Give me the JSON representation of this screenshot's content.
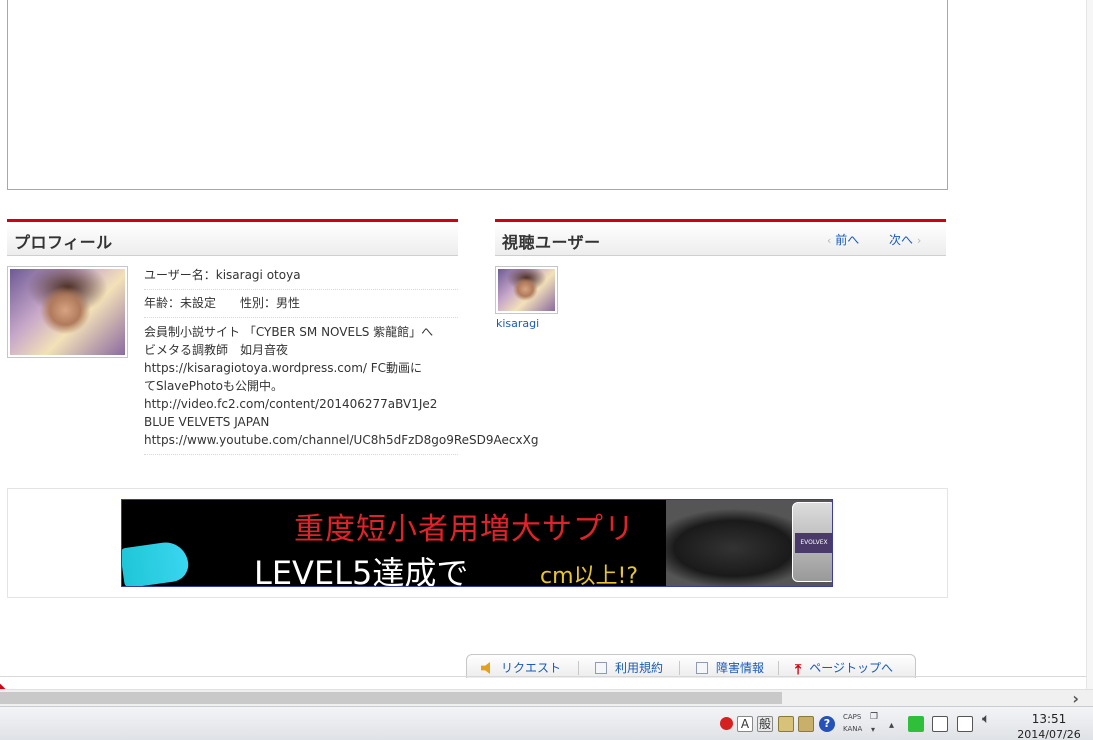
{
  "profile": {
    "title": "プロフィール",
    "username_line": "ユーザー名：kisaragi otoya",
    "age_line": "年齢：未設定",
    "gender_line": "性別：男性",
    "bio": "会員制小説サイト 「CYBER SM NOVELS 紫龍館」へ\nビメタる調教師　如月音夜\nhttps://kisaragiotoya.wordpress.com/ FC動画に\nてSlavePhotoも公開中。\nhttp://video.fc2.com/content/201406277aBV1Je2\nBLUE VELVETS JAPAN\nhttps://www.youtube.com/channel/UC8h5dFzD8go9ReSD9AecxXg"
  },
  "viewers": {
    "title": "視聴ユーザー",
    "prev_label": "前へ",
    "next_label": "次へ",
    "users": [
      {
        "name": "kisaragi"
      }
    ]
  },
  "ad": {
    "headline": "重度短小者用増大サプリ",
    "main_text": "LEVEL5達成で",
    "sub_text": "cm以上!?",
    "bottle_label": "EVOLVEX"
  },
  "footer": {
    "tabs": [
      {
        "label": "リクエスト",
        "icon": "speaker-icon"
      },
      {
        "label": "利用規約",
        "icon": "document-icon"
      },
      {
        "label": "障害情報",
        "icon": "document-icon"
      },
      {
        "label": "ページトップへ",
        "icon": "arrow-up-icon"
      }
    ]
  },
  "taskbar": {
    "ime_mode": "A",
    "ime_kanji": "般",
    "caps_label": "CAPS",
    "kana_label": "KANA",
    "time": "13:51",
    "date": "2014/07/26"
  },
  "colors": {
    "accent_red": "#d0000f",
    "link_blue": "#1a5ab8"
  }
}
